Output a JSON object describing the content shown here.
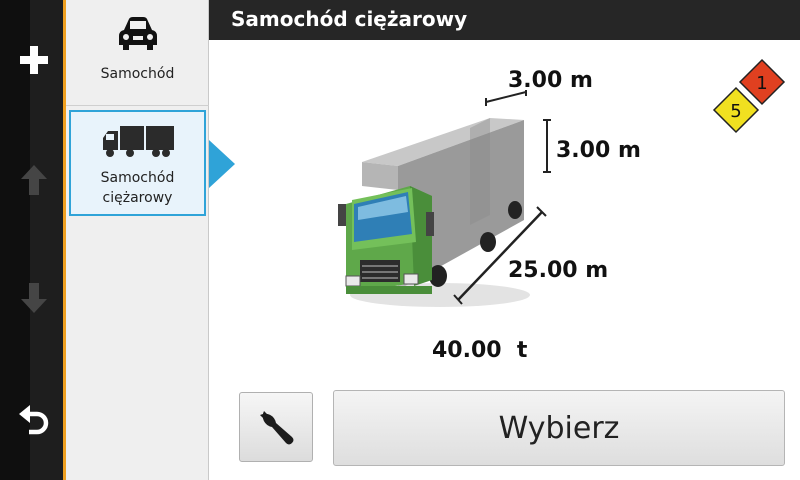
{
  "title": "Samochód ciężarowy",
  "vehicles": [
    {
      "label": "Samochód",
      "icon": "car-icon",
      "selected": false
    },
    {
      "label": "Samochód\nciężarowy",
      "icon": "truck-icon",
      "selected": true
    }
  ],
  "nav": {
    "icons": [
      "plus-icon",
      "arrow-up-icon",
      "arrow-down-icon",
      "back-icon"
    ]
  },
  "dimensions": {
    "width": "3.00 m",
    "height": "3.00 m",
    "length": "25.00 m",
    "weight": "40.00  t"
  },
  "hazmat": {
    "classes": [
      "5",
      "1"
    ],
    "colors": [
      "#f0e020",
      "#e04020"
    ]
  },
  "buttons": {
    "tools_icon": "wrench-icon",
    "select_label": "Wybierz"
  },
  "colors": {
    "accent": "#2fa3d8",
    "highlight": "#f0a020",
    "title_bar": "#262626"
  }
}
